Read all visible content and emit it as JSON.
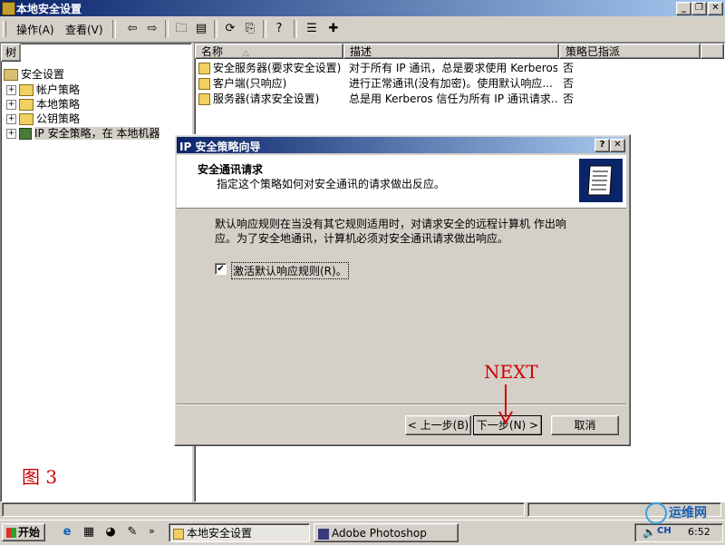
{
  "window": {
    "title": "本地安全设置"
  },
  "menu": {
    "action": "操作(A)",
    "view": "查看(V)"
  },
  "toolbar": {
    "icons": [
      "back-icon",
      "forward-icon",
      "up-folder-icon",
      "show-tree-icon",
      "refresh-icon",
      "export-icon",
      "help-icon",
      "properties-icon",
      "new-policy-icon"
    ]
  },
  "tree": {
    "header": "树",
    "items": [
      {
        "label": "安全设置",
        "indent": 0
      },
      {
        "label": "帐户策略",
        "indent": 1
      },
      {
        "label": "本地策略",
        "indent": 1
      },
      {
        "label": "公钥策略",
        "indent": 1
      },
      {
        "label": "IP 安全策略，在 本地机器",
        "indent": 1
      }
    ]
  },
  "list": {
    "columns": {
      "name": "名称",
      "desc": "描述",
      "assigned": "策略已指派"
    },
    "rows": [
      {
        "name": "安全服务器(要求安全设置)",
        "desc": "对于所有 IP 通讯，总是要求使用 Kerberos...",
        "assigned": "否"
      },
      {
        "name": "客户端(只响应)",
        "desc": "进行正常通讯(没有加密)。使用默认响应...",
        "assigned": "否"
      },
      {
        "name": "服务器(请求安全设置)",
        "desc": "总是用 Kerberos 信任为所有 IP 通讯请求...",
        "assigned": "否"
      }
    ]
  },
  "dialog": {
    "title": "IP 安全策略向导",
    "heading": "安全通讯请求",
    "subheading": "指定这个策略如何对安全通讯的请求做出反应。",
    "body": "默认响应规则在当没有其它规则适用时，对请求安全的远程计算机 作出响应。为了安全地通讯，计算机必须对安全通讯请求做出响应。",
    "checkbox_label": "激活默认响应规则(R)。",
    "checkbox_checked": true,
    "back": "< 上一步(B)",
    "next": "下一步(N) >",
    "cancel": "取消"
  },
  "annotation": {
    "next_label": "NEXT",
    "figure_label": "图 3",
    "color": "#cc0000"
  },
  "taskbar": {
    "start": "开始",
    "tasks": [
      "本地安全设置",
      "Adobe Photoshop"
    ],
    "clock": "6:52",
    "watermark": "运维网"
  }
}
